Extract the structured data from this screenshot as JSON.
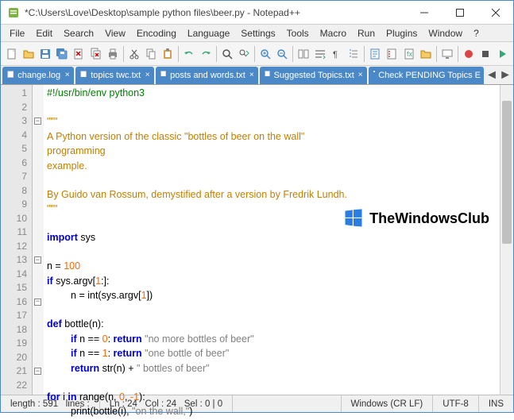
{
  "window": {
    "title": "*C:\\Users\\Love\\Desktop\\sample python files\\beer.py - Notepad++"
  },
  "menu": {
    "items": [
      "File",
      "Edit",
      "Search",
      "View",
      "Encoding",
      "Language",
      "Settings",
      "Tools",
      "Macro",
      "Run",
      "Plugins",
      "Window",
      "?"
    ]
  },
  "tabs": {
    "items": [
      {
        "label": "change.log"
      },
      {
        "label": "topics twc.txt"
      },
      {
        "label": "posts and words.txt"
      },
      {
        "label": "Suggested Topics.txt"
      },
      {
        "label": "Check PENDING Topics E"
      }
    ]
  },
  "editor": {
    "line_numbers": [
      "1",
      "2",
      "3",
      "4",
      "5",
      "6",
      "7",
      "8",
      "9",
      "10",
      "11",
      "12",
      "13",
      "14",
      "15",
      "16",
      "17",
      "18",
      "19",
      "20",
      "21",
      "22"
    ],
    "lines": [
      {
        "t": "comment",
        "text": "#!/usr/bin/env python3"
      },
      {
        "t": "blank",
        "text": ""
      },
      {
        "t": "str3",
        "text": "\"\"\""
      },
      {
        "t": "str3",
        "text": "A Python version of the classic \"bottles of beer on the wall\""
      },
      {
        "t": "str3",
        "text": "programming"
      },
      {
        "t": "str3",
        "text": "example."
      },
      {
        "t": "blank",
        "text": ""
      },
      {
        "t": "str3",
        "text": "By Guido van Rossum, demystified after a version by Fredrik Lundh."
      },
      {
        "t": "str3",
        "text": "\"\"\""
      },
      {
        "t": "blank",
        "text": ""
      },
      {
        "t": "import",
        "kw": "import",
        "rest": " sys"
      },
      {
        "t": "blank",
        "text": ""
      },
      {
        "t": "assign",
        "lhs": "n = ",
        "num": "100"
      },
      {
        "t": "if",
        "pre": "if ",
        "mid": "sys.argv[",
        "num": "1",
        "post": ":]:"
      },
      {
        "t": "assign2",
        "indent": "    ",
        "lhs": "n = int(sys.argv[",
        "num": "1",
        "post": "])"
      },
      {
        "t": "blank",
        "text": ""
      },
      {
        "t": "def",
        "pre": "def ",
        "name": "bottle(n):"
      },
      {
        "t": "ifret",
        "indent": "    ",
        "pre": "if ",
        "cond": "n == ",
        "num": "0",
        "mid": ": ",
        "kw2": "return",
        "str": " \"no more bottles of beer\""
      },
      {
        "t": "ifret",
        "indent": "    ",
        "pre": "if ",
        "cond": "n == ",
        "num": "1",
        "mid": ": ",
        "kw2": "return",
        "str": " \"one bottle of beer\""
      },
      {
        "t": "ret",
        "indent": "    ",
        "kw": "return",
        "mid": " str(n) + ",
        "str": "\" bottles of beer\""
      },
      {
        "t": "blank",
        "text": ""
      },
      {
        "t": "for",
        "pre": "for ",
        "mid": "i ",
        "kw2": "in",
        "rest": " range(n, ",
        "num1": "0",
        "c": ", ",
        "num2": "-1",
        "post": "):"
      },
      {
        "t": "print",
        "indent": "    ",
        "call": "print(bottle(i), ",
        "str": "\"on the wall,\"",
        "post": ")"
      }
    ]
  },
  "status": {
    "length": "length : 591",
    "lines": "lines :",
    "ln": "Ln : 24",
    "col": "Col : 24",
    "sel": "Sel : 0 | 0",
    "eol": "Windows (CR LF)",
    "enc": "UTF-8",
    "mode": "INS"
  },
  "watermark": "TheWindowsClub"
}
